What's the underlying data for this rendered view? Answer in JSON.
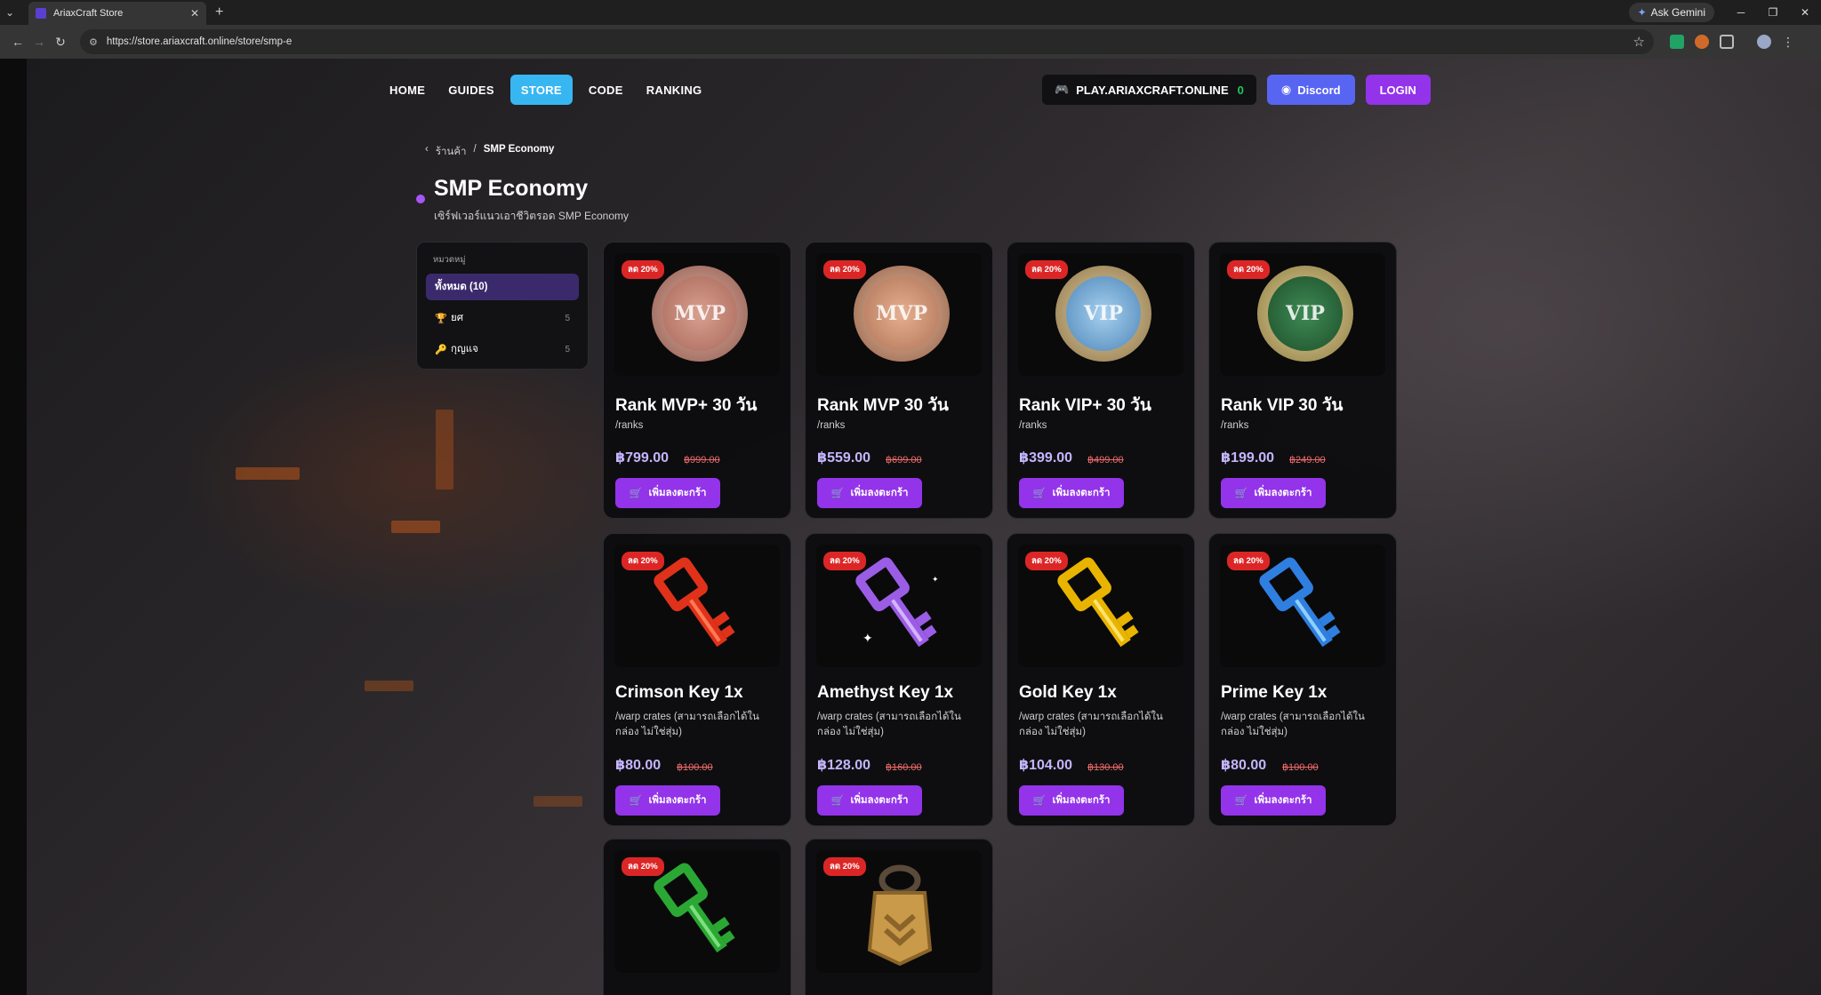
{
  "browser": {
    "tab_title": "AriaxCraft Store",
    "url": "https://store.ariaxcraft.online/store/smp-e",
    "ask_gemini": "Ask Gemini"
  },
  "nav": {
    "home": "HOME",
    "guides": "GUIDES",
    "store": "STORE",
    "code": "CODE",
    "ranking": "RANKING"
  },
  "header": {
    "server": "PLAY.ARIAXCRAFT.ONLINE",
    "online": "0",
    "discord": "Discord",
    "login": "LOGIN"
  },
  "breadcrumb": {
    "store": "ร้านค้า",
    "current": "SMP Economy"
  },
  "page": {
    "title": "SMP Economy",
    "subtitle": "เซิร์ฟเวอร์แนวเอาชีวิตรอด SMP Economy"
  },
  "sidebar": {
    "heading": "หมวดหมู่",
    "items": [
      {
        "label": "ทั้งหมด (10)",
        "count": ""
      },
      {
        "label": "ยศ",
        "count": "5"
      },
      {
        "label": "กุญแจ",
        "count": "5"
      }
    ]
  },
  "products": [
    {
      "badge": "ลด 20%",
      "name": "Rank MVP+ 30 วัน",
      "desc": "/ranks",
      "price": "฿799.00",
      "old": "฿999.00",
      "btn": "เพิ่มลงตะกร้า"
    },
    {
      "badge": "ลด 20%",
      "name": "Rank MVP 30 วัน",
      "desc": "/ranks",
      "price": "฿559.00",
      "old": "฿699.00",
      "btn": "เพิ่มลงตะกร้า"
    },
    {
      "badge": "ลด 20%",
      "name": "Rank VIP+ 30 วัน",
      "desc": "/ranks",
      "price": "฿399.00",
      "old": "฿499.00",
      "btn": "เพิ่มลงตะกร้า"
    },
    {
      "badge": "ลด 20%",
      "name": "Rank VIP 30 วัน",
      "desc": "/ranks",
      "price": "฿199.00",
      "old": "฿249.00",
      "btn": "เพิ่มลงตะกร้า"
    },
    {
      "badge": "ลด 20%",
      "name": "Crimson Key 1x",
      "desc": "/warp crates (สามารถเลือกได้ในกล่อง ไม่ใช่สุ่ม)",
      "price": "฿80.00",
      "old": "฿100.00",
      "btn": "เพิ่มลงตะกร้า"
    },
    {
      "badge": "ลด 20%",
      "name": "Amethyst Key 1x",
      "desc": "/warp crates (สามารถเลือกได้ในกล่อง ไม่ใช่สุ่ม)",
      "price": "฿128.00",
      "old": "฿160.00",
      "btn": "เพิ่มลงตะกร้า"
    },
    {
      "badge": "ลด 20%",
      "name": "Gold Key 1x",
      "desc": "/warp crates (สามารถเลือกได้ในกล่อง ไม่ใช่สุ่ม)",
      "price": "฿104.00",
      "old": "฿130.00",
      "btn": "เพิ่มลงตะกร้า"
    },
    {
      "badge": "ลด 20%",
      "name": "Prime Key 1x",
      "desc": "/warp crates (สามารถเลือกได้ในกล่อง ไม่ใช่สุ่ม)",
      "price": "฿80.00",
      "old": "฿100.00",
      "btn": "เพิ่มลงตะกร้า"
    },
    {
      "badge": "ลด 20%"
    },
    {
      "badge": "ลด 20%"
    }
  ],
  "medals": [
    {
      "label": "MVP",
      "color": "#c98f83"
    },
    {
      "label": "MVP",
      "color": "#d49c7e"
    },
    {
      "label": "VIP",
      "color": "#7fb0d8"
    },
    {
      "label": "VIP",
      "color": "#2f6b3f"
    }
  ],
  "keys": [
    {
      "color": "#e0321a",
      "light": "#ff7a55"
    },
    {
      "color": "#9b5de5",
      "light": "#d5b4ff"
    },
    {
      "color": "#e8b400",
      "light": "#ffe36b"
    },
    {
      "color": "#2f7fe0",
      "light": "#8fd0ff"
    },
    {
      "color": "#2ba834",
      "light": "#7de07f"
    }
  ]
}
